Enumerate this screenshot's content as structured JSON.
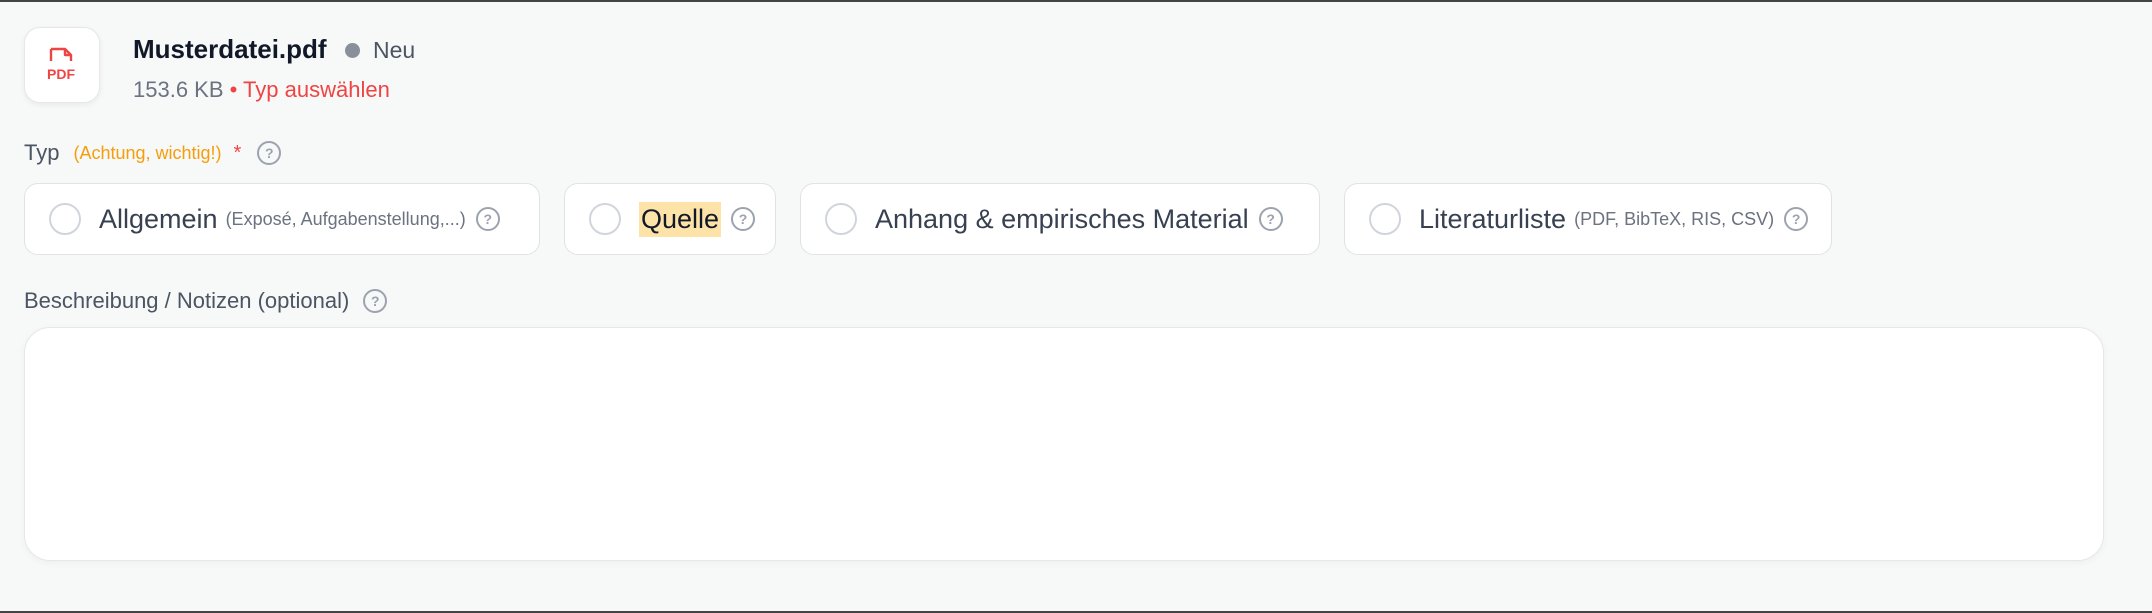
{
  "file": {
    "name": "Musterdatei.pdf",
    "icon_text": "PDF",
    "status": "Neu",
    "size": "153.6 KB",
    "warning": "• Typ auswählen"
  },
  "type_field": {
    "label": "Typ",
    "hint": "(Achtung, wichtig!)",
    "required_mark": "*",
    "options": [
      {
        "label": "Allgemein",
        "hint": "(Exposé, Aufgabenstellung,...)"
      },
      {
        "label": "Quelle",
        "hint": ""
      },
      {
        "label": "Anhang & empirisches Material",
        "hint": ""
      },
      {
        "label": "Literaturliste",
        "hint": "(PDF, BibTeX, RIS, CSV)"
      }
    ]
  },
  "description_field": {
    "label": "Beschreibung / Notizen (optional)",
    "value": ""
  },
  "help_glyph": "?",
  "colors": {
    "accent_warning": "#f59e0b",
    "error": "#ef4444",
    "highlight": "#fde3a7",
    "status_dot": "#8a9099",
    "pdf_icon": "#ef4444"
  }
}
